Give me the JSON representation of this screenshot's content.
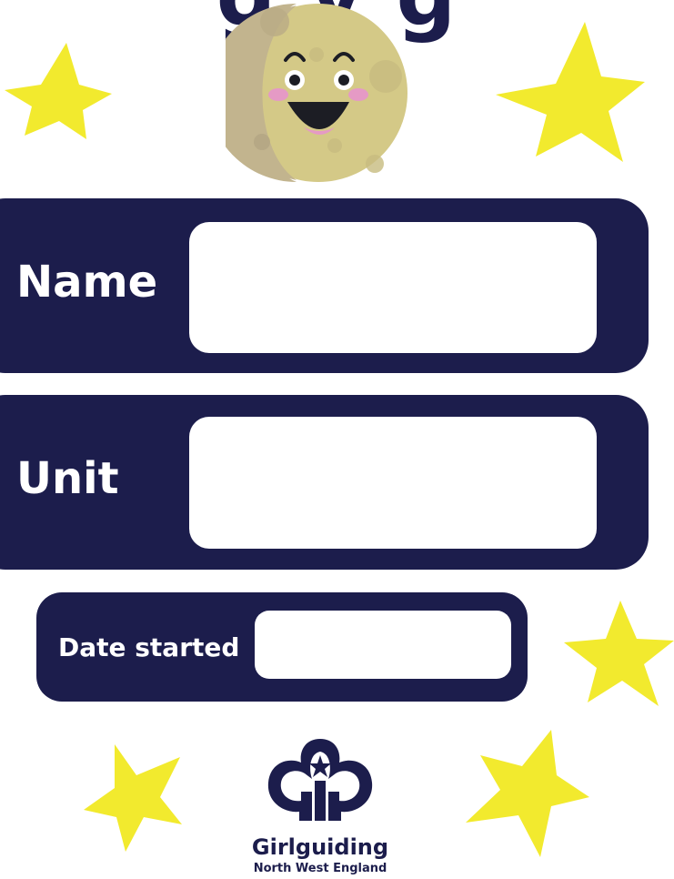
{
  "title_partial": "g         y  g",
  "fields": {
    "name_label": "Name",
    "unit_label": "Unit",
    "date_label": "Date started",
    "name_value": "",
    "unit_value": "",
    "date_value": ""
  },
  "logo": {
    "brand": "Girlguiding",
    "region": "North West England"
  },
  "colors": {
    "navy": "#1c1d4c",
    "star": "#f2ea2e",
    "moon": "#d4c987",
    "moon_shadow": "#c2b48e",
    "cheek": "#e59ac5"
  }
}
